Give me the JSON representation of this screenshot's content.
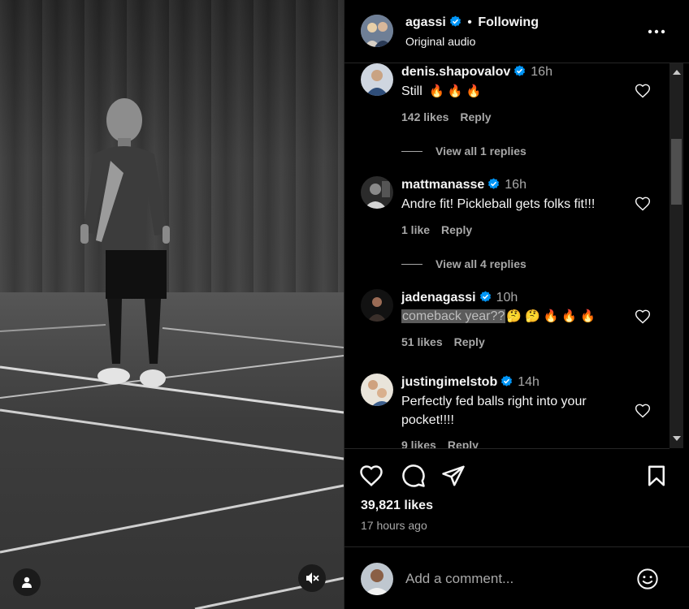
{
  "video": {
    "mute_icon": "speaker-muted-icon",
    "profile_icon": "person-icon"
  },
  "header": {
    "username": "agassi",
    "separator": "•",
    "follow_status": "Following",
    "audio": "Original audio",
    "more_icon": "more-horizontal-icon"
  },
  "comments": [
    {
      "username": "denis.shapovalov",
      "time": "16h",
      "text": "Still",
      "emojis": [
        "🔥",
        "🔥",
        "🔥"
      ],
      "likes": "142 likes",
      "reply": "Reply",
      "view_replies": "View all 1 replies"
    },
    {
      "username": "mattmanasse",
      "time": "16h",
      "text": "Andre fit! Pickleball gets folks fit!!!",
      "likes": "1 like",
      "reply": "Reply",
      "view_replies": "View all 4 replies"
    },
    {
      "username": "jadenagassi",
      "time": "10h",
      "text": "comeback year??",
      "emojis": [
        "🤔",
        "🤔",
        "🔥",
        "🔥",
        "🔥"
      ],
      "likes": "51 likes",
      "reply": "Reply"
    },
    {
      "username": "justingimelstob",
      "time": "14h",
      "text": "Perfectly fed balls right into your pocket!!!!",
      "likes": "9 likes",
      "reply": "Reply"
    }
  ],
  "actions": {
    "like_icon": "heart-icon",
    "comment_icon": "comment-icon",
    "share_icon": "send-icon",
    "save_icon": "bookmark-icon",
    "likes": "39,821 likes",
    "time_ago": "17 hours ago"
  },
  "compose": {
    "placeholder": "Add a comment...",
    "emoji_icon": "smiley-icon"
  },
  "colors": {
    "verified": "#0095f6",
    "text": "#f5f5f5",
    "secondary": "#a8a8a8",
    "divider": "#262626"
  }
}
